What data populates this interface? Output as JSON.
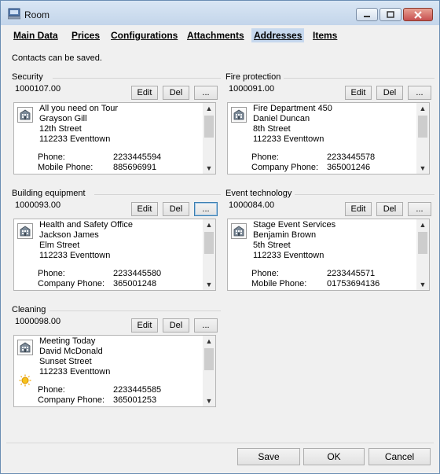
{
  "window": {
    "title": "Room"
  },
  "tabs": [
    "Main Data",
    "Prices",
    "Configurations",
    "Attachments",
    "Addresses",
    "Items"
  ],
  "notice": "Contacts can be saved.",
  "buttons": {
    "edit": "Edit",
    "del": "Del",
    "more": "..."
  },
  "groups": [
    {
      "title": "Security",
      "number": "1000107.00",
      "lines": [
        "All you need on Tour",
        "Grayson Gill",
        "12th Street",
        "112233 Eventtown"
      ],
      "phones": [
        [
          "Phone:",
          "2233445594"
        ],
        [
          "Mobile Phone:",
          "885696991"
        ]
      ]
    },
    {
      "title": "Fire protection",
      "number": "1000091.00",
      "lines": [
        "Fire Department 450",
        "Daniel Duncan",
        "8th Street",
        "112233 Eventtown"
      ],
      "phones": [
        [
          "Phone:",
          "2233445578"
        ],
        [
          "Company Phone:",
          "365001246"
        ]
      ]
    },
    {
      "title": "Building equipment",
      "number": "1000093.00",
      "lines": [
        "Health and Safety Office",
        "Jackson James",
        "Elm Street",
        "112233 Eventtown"
      ],
      "phones": [
        [
          "Phone:",
          "2233445580"
        ],
        [
          "Company Phone:",
          "365001248"
        ]
      ]
    },
    {
      "title": "Event technology",
      "number": "1000084.00",
      "lines": [
        "Stage Event Services",
        "Benjamin Brown",
        "5th Street",
        "112233 Eventtown"
      ],
      "phones": [
        [
          "Phone:",
          "2233445571"
        ],
        [
          "Mobile Phone:",
          "01753694136"
        ]
      ]
    },
    {
      "title": "Cleaning",
      "number": "1000098.00",
      "lines": [
        "Meeting Today",
        "David McDonald",
        "Sunset Street",
        "112233 Eventtown"
      ],
      "phones": [
        [
          "Phone:",
          "2233445585"
        ],
        [
          "Company Phone:",
          "365001253"
        ]
      ]
    }
  ],
  "footer": {
    "save": "Save",
    "ok": "OK",
    "cancel": "Cancel"
  }
}
